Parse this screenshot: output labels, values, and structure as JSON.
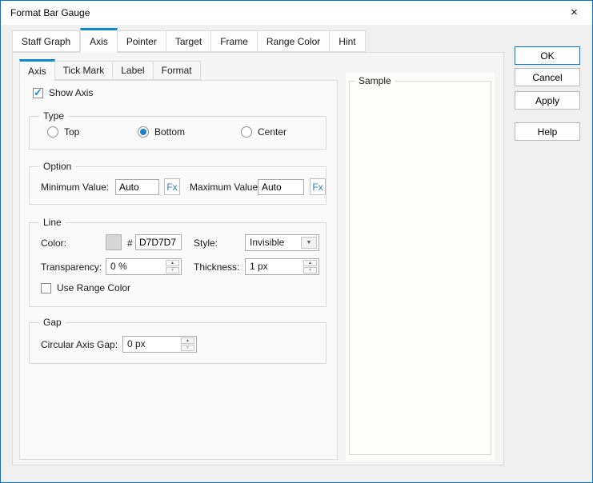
{
  "window": {
    "title": "Format Bar Gauge"
  },
  "icons": {
    "close": "×",
    "check": "✓",
    "dropdown_arrow": "▼",
    "spin_up": "▲",
    "spin_down": "▼"
  },
  "colors": {
    "accent_blue": "#1187d2",
    "ok_border_blue": "#0078d7",
    "fx_text_blue": "#2779d8",
    "line_color_swatch": "#D7D7D7",
    "dialog_bg": "#f0f0f0",
    "titlebar_bg": "#ffffff"
  },
  "tabs": {
    "selected": "Axis",
    "items": [
      {
        "label": "Staff Graph"
      },
      {
        "label": "Axis"
      },
      {
        "label": "Pointer"
      },
      {
        "label": "Target"
      },
      {
        "label": "Frame"
      },
      {
        "label": "Range Color"
      },
      {
        "label": "Hint"
      }
    ]
  },
  "subtabs": {
    "selected": "Axis",
    "items": [
      {
        "label": "Axis"
      },
      {
        "label": "Tick Mark"
      },
      {
        "label": "Label"
      },
      {
        "label": "Format"
      }
    ]
  },
  "axis_page": {
    "show_axis": {
      "label": "Show Axis",
      "checked": true
    },
    "type_group": {
      "label": "Type",
      "options": [
        {
          "label": "Top",
          "selected": false
        },
        {
          "label": "Bottom",
          "selected": true
        },
        {
          "label": "Center",
          "selected": false
        }
      ]
    },
    "option_group": {
      "label": "Option",
      "minimum": {
        "label": "Minimum Value:",
        "value": "Auto"
      },
      "maximum": {
        "label": "Maximum Value:",
        "value": "Auto"
      },
      "fx_label": "Fx"
    },
    "line_group": {
      "label": "Line",
      "color": {
        "label": "Color:",
        "hash": "#",
        "hex": "D7D7D7"
      },
      "style": {
        "label": "Style:",
        "value": "Invisible"
      },
      "transparency": {
        "label": "Transparency:",
        "value": "0 %"
      },
      "thickness": {
        "label": "Thickness:",
        "value": "1 px"
      },
      "use_range_color": {
        "label": "Use Range Color",
        "checked": false
      }
    },
    "gap_group": {
      "label": "Gap",
      "circular_axis_gap": {
        "label": "Circular Axis Gap:",
        "value": "0 px"
      }
    }
  },
  "sample_group": {
    "label": "Sample"
  },
  "buttons": [
    {
      "label": "OK",
      "default": true
    },
    {
      "label": "Cancel",
      "default": false
    },
    {
      "label": "Apply",
      "default": false
    },
    {
      "label": "Help",
      "default": false
    }
  ]
}
